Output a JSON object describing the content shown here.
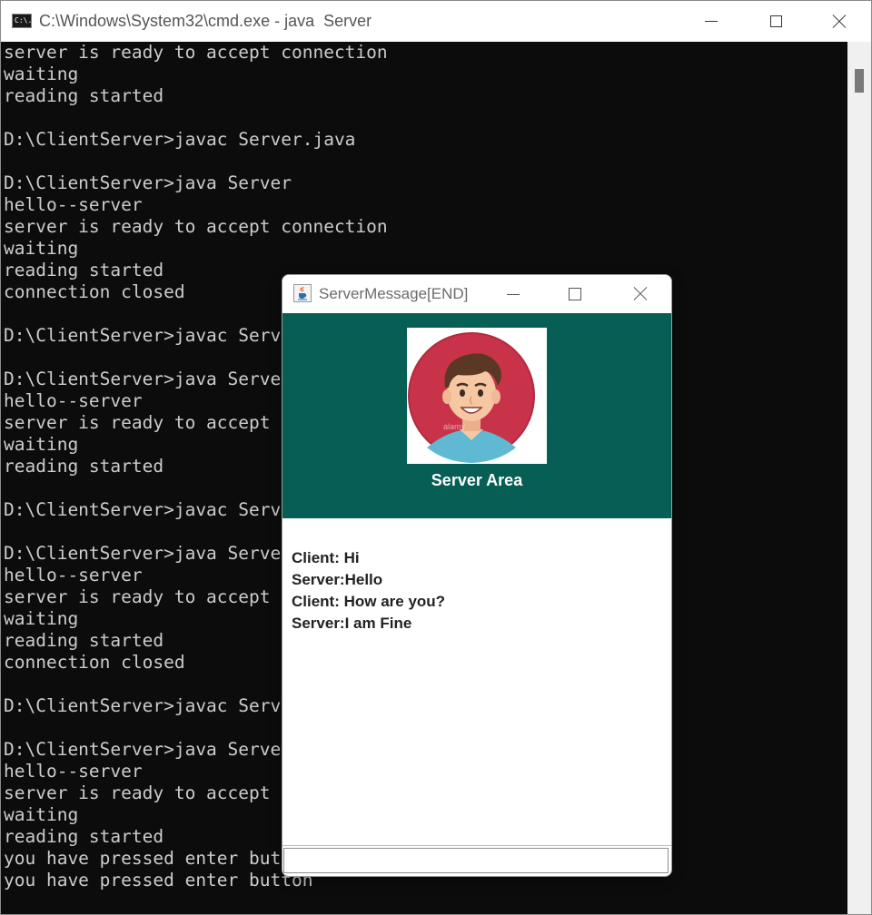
{
  "cmd": {
    "title": "C:\\Windows\\System32\\cmd.exe - java  Server",
    "icon_text": "C:\\.",
    "lines": [
      "server is ready to accept connection",
      "waiting",
      "reading started",
      "",
      "D:\\ClientServer>javac Server.java",
      "",
      "D:\\ClientServer>java Server",
      "hello--server",
      "server is ready to accept connection",
      "waiting",
      "reading started",
      "connection closed",
      "",
      "D:\\ClientServer>javac Server.java",
      "",
      "D:\\ClientServer>java Server",
      "hello--server",
      "server is ready to accept connection",
      "waiting",
      "reading started",
      "",
      "D:\\ClientServer>javac Server.java",
      "",
      "D:\\ClientServer>java Server",
      "hello--server",
      "server is ready to accept connection",
      "waiting",
      "reading started",
      "connection closed",
      "",
      "D:\\ClientServer>javac Server.java",
      "",
      "D:\\ClientServer>java Server",
      "hello--server",
      "server is ready to accept connection",
      "waiting",
      "reading started",
      "you have pressed enter button",
      "you have pressed enter button"
    ]
  },
  "dialog": {
    "title": "ServerMessage[END]",
    "header_title": "Server Area",
    "avatar_watermark": "alamy",
    "messages": [
      "Client: Hi",
      "Server:Hello",
      "Client: How are you?",
      "Server:I am Fine"
    ],
    "input_value": ""
  },
  "colors": {
    "console_bg": "#0c0c0c",
    "console_text": "#cccccc",
    "header_bg": "#075e54",
    "avatar_bg": "#c8334a"
  }
}
